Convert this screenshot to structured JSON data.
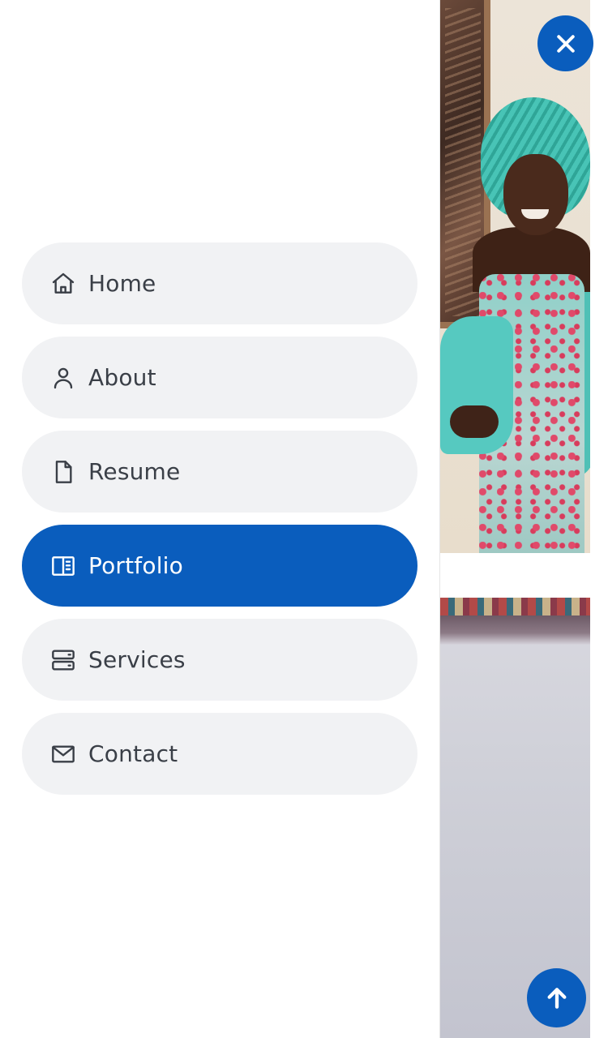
{
  "theme": {
    "accent": "#0a5dbd",
    "item_bg": "#f1f2f4",
    "text": "#3a3f47"
  },
  "nav": {
    "items": [
      {
        "label": "Home",
        "icon": "house-icon",
        "active": false
      },
      {
        "label": "About",
        "icon": "person-icon",
        "active": false
      },
      {
        "label": "Resume",
        "icon": "file-icon",
        "active": false
      },
      {
        "label": "Portfolio",
        "icon": "portfolio-icon",
        "active": true
      },
      {
        "label": "Services",
        "icon": "server-icon",
        "active": false
      },
      {
        "label": "Contact",
        "icon": "envelope-icon",
        "active": false
      }
    ]
  },
  "buttons": {
    "close": {
      "icon": "close-icon"
    },
    "back_to_top": {
      "icon": "arrow-up-icon"
    }
  }
}
